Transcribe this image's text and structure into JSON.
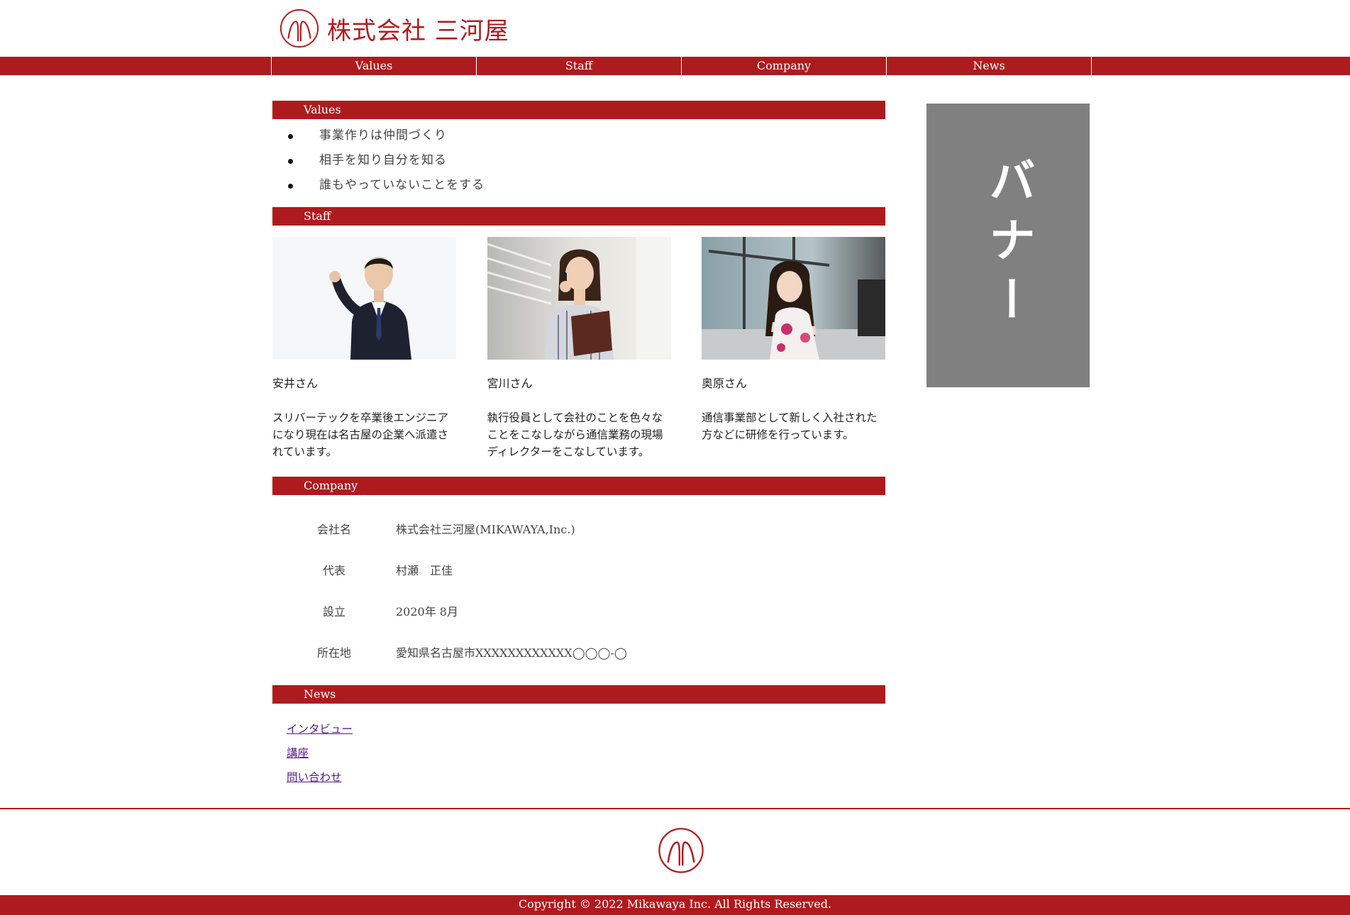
{
  "header": {
    "company_name": "株式会社 三河屋",
    "logo_icon": "mikawaya-logo-icon"
  },
  "nav": {
    "items": [
      {
        "label": "Values"
      },
      {
        "label": "Staff"
      },
      {
        "label": "Company"
      },
      {
        "label": "News"
      }
    ]
  },
  "values": {
    "heading": "Values",
    "items": [
      "事業作りは仲間づくり",
      "相手を知り自分を知る",
      "誰もやっていないことをする"
    ]
  },
  "staff": {
    "heading": "Staff",
    "members": [
      {
        "name": "安井さん",
        "description": "スリバーテックを卒業後エンジニアになり現在は名古屋の企業へ派遣されています。"
      },
      {
        "name": "宮川さん",
        "description": "執行役員として会社のことを色々なことをこなしながら通信業務の現場ディレクターをこなしています。"
      },
      {
        "name": "奥原さん",
        "description": "通信事業部として新しく入社された方などに研修を行っています。"
      }
    ]
  },
  "company": {
    "heading": "Company",
    "rows": [
      {
        "key": "会社名",
        "value": "株式会社三河屋(MIKAWAYA,Inc.)"
      },
      {
        "key": "代表",
        "value": "村瀬　正佳"
      },
      {
        "key": "設立",
        "value": "2020年 8月"
      },
      {
        "key": "所在地",
        "value": "愛知県名古屋市XXXXXXXXXXXX◯◯◯-◯"
      }
    ]
  },
  "news": {
    "heading": "News",
    "links": [
      {
        "label": "インタビュー"
      },
      {
        "label": "講座"
      },
      {
        "label": "問い合わせ"
      }
    ]
  },
  "banner": {
    "text": "バナー"
  },
  "footer": {
    "copyright": "Copyright © 2022 Mikawaya Inc. All Rights Reserved."
  },
  "colors": {
    "brand_red": "#ae1b1f",
    "banner_gray": "#808080",
    "link_visited": "#551a8b"
  }
}
